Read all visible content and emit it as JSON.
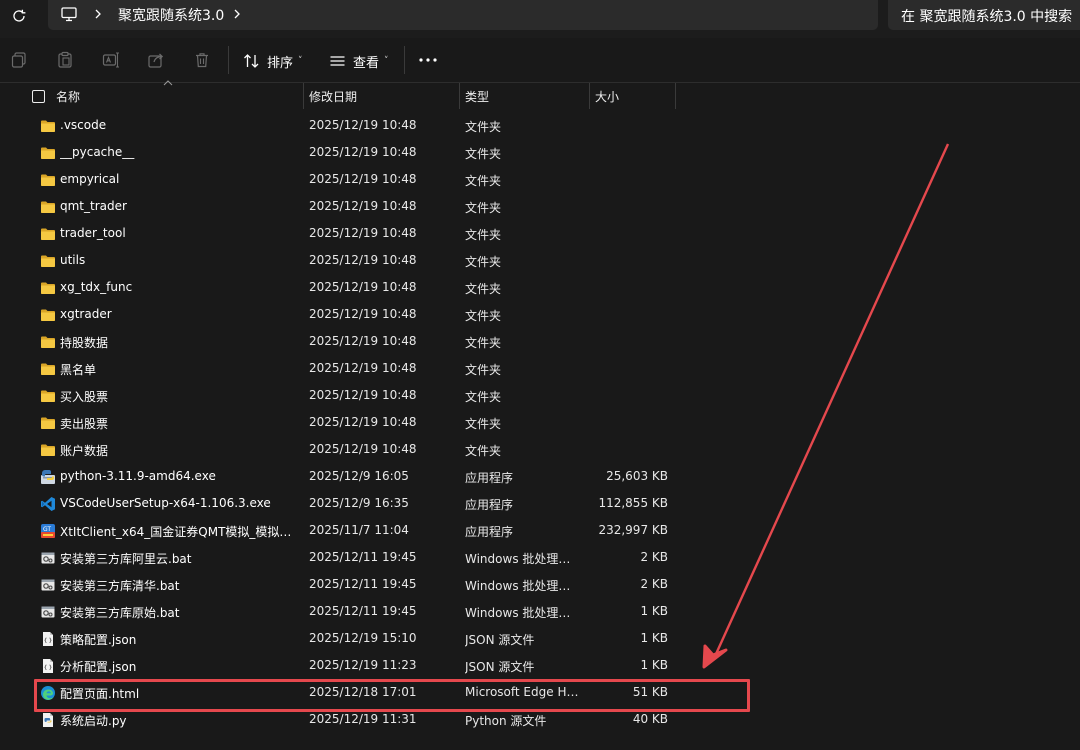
{
  "address": {
    "crumb": "聚宽跟随系统3.0",
    "search_placeholder": "在 聚宽跟随系统3.0 中搜索"
  },
  "toolbar": {
    "icons": [
      "copy-icon",
      "paste-icon",
      "rename-icon",
      "share-icon",
      "delete-icon"
    ],
    "sort_label": "排序",
    "view_label": "查看"
  },
  "columns": {
    "name": "名称",
    "date": "修改日期",
    "type": "类型",
    "size": "大小"
  },
  "files": [
    {
      "icon": "folder-icon",
      "name": ".vscode",
      "date": "2025/12/19 10:48",
      "type": "文件夹",
      "size": ""
    },
    {
      "icon": "folder-icon",
      "name": "__pycache__",
      "date": "2025/12/19 10:48",
      "type": "文件夹",
      "size": ""
    },
    {
      "icon": "folder-icon",
      "name": "empyrical",
      "date": "2025/12/19 10:48",
      "type": "文件夹",
      "size": ""
    },
    {
      "icon": "folder-icon",
      "name": "qmt_trader",
      "date": "2025/12/19 10:48",
      "type": "文件夹",
      "size": ""
    },
    {
      "icon": "folder-icon",
      "name": "trader_tool",
      "date": "2025/12/19 10:48",
      "type": "文件夹",
      "size": ""
    },
    {
      "icon": "folder-icon",
      "name": "utils",
      "date": "2025/12/19 10:48",
      "type": "文件夹",
      "size": ""
    },
    {
      "icon": "folder-icon",
      "name": "xg_tdx_func",
      "date": "2025/12/19 10:48",
      "type": "文件夹",
      "size": ""
    },
    {
      "icon": "folder-icon",
      "name": "xgtrader",
      "date": "2025/12/19 10:48",
      "type": "文件夹",
      "size": ""
    },
    {
      "icon": "folder-icon",
      "name": "持股数据",
      "date": "2025/12/19 10:48",
      "type": "文件夹",
      "size": ""
    },
    {
      "icon": "folder-icon",
      "name": "黑名单",
      "date": "2025/12/19 10:48",
      "type": "文件夹",
      "size": ""
    },
    {
      "icon": "folder-icon",
      "name": "买入股票",
      "date": "2025/12/19 10:48",
      "type": "文件夹",
      "size": ""
    },
    {
      "icon": "folder-icon",
      "name": "卖出股票",
      "date": "2025/12/19 10:48",
      "type": "文件夹",
      "size": ""
    },
    {
      "icon": "folder-icon",
      "name": "账户数据",
      "date": "2025/12/19 10:48",
      "type": "文件夹",
      "size": ""
    },
    {
      "icon": "python-installer-icon",
      "name": "python-3.11.9-amd64.exe",
      "date": "2025/12/9 16:05",
      "type": "应用程序",
      "size": "25,603 KB"
    },
    {
      "icon": "vscode-icon",
      "name": "VSCodeUserSetup-x64-1.106.3.exe",
      "date": "2025/12/9 16:35",
      "type": "应用程序",
      "size": "112,855 KB"
    },
    {
      "icon": "app-installer-icon",
      "name": "XtItClient_x64_国金证券QMT模拟_模拟_2....",
      "date": "2025/11/7 11:04",
      "type": "应用程序",
      "size": "232,997 KB"
    },
    {
      "icon": "batch-file-icon",
      "name": "安装第三方库阿里云.bat",
      "date": "2025/12/11 19:45",
      "type": "Windows 批处理文件",
      "size": "2 KB"
    },
    {
      "icon": "batch-file-icon",
      "name": "安装第三方库清华.bat",
      "date": "2025/12/11 19:45",
      "type": "Windows 批处理文件",
      "size": "2 KB"
    },
    {
      "icon": "batch-file-icon",
      "name": "安装第三方库原始.bat",
      "date": "2025/12/11 19:45",
      "type": "Windows 批处理文件",
      "size": "1 KB"
    },
    {
      "icon": "json-file-icon",
      "name": "策略配置.json",
      "date": "2025/12/19 15:10",
      "type": "JSON 源文件",
      "size": "1 KB"
    },
    {
      "icon": "json-file-icon",
      "name": "分析配置.json",
      "date": "2025/12/19 11:23",
      "type": "JSON 源文件",
      "size": "1 KB"
    },
    {
      "icon": "edge-html-icon",
      "name": "配置页面.html",
      "date": "2025/12/18 17:01",
      "type": "Microsoft Edge HT...",
      "size": "51 KB"
    },
    {
      "icon": "python-file-icon",
      "name": "系统启动.py",
      "date": "2025/12/19 11:31",
      "type": "Python 源文件",
      "size": "40 KB"
    }
  ],
  "colors": {
    "background": "#191919",
    "folder": "#f0c53c",
    "annotation": "#e5484d"
  }
}
